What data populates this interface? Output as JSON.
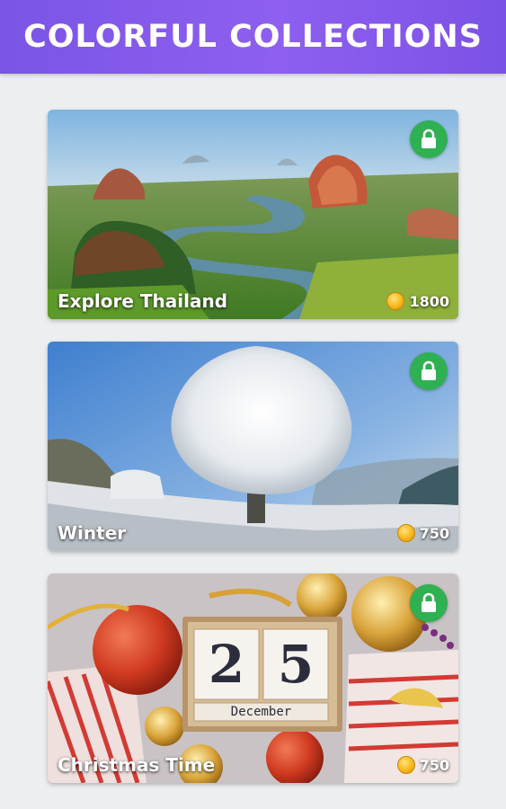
{
  "header": {
    "title": "COLORFUL COLLECTIONS"
  },
  "collections": [
    {
      "title": "Explore Thailand",
      "price": "1800",
      "locked": true,
      "lock_icon": "lock-icon",
      "coin_icon": "coin-icon"
    },
    {
      "title": "Winter",
      "price": "750",
      "locked": true,
      "lock_icon": "lock-icon",
      "coin_icon": "coin-icon"
    },
    {
      "title": "Christmas Time",
      "price": "750",
      "locked": true,
      "lock_icon": "lock-icon",
      "coin_icon": "coin-icon"
    }
  ],
  "colors": {
    "header": "#8a5cf0",
    "lock": "#2fb052",
    "coin": "#f7b719",
    "background": "#eceef0"
  },
  "calendar": {
    "day_digit_1": "2",
    "day_digit_2": "5",
    "month": "December"
  }
}
